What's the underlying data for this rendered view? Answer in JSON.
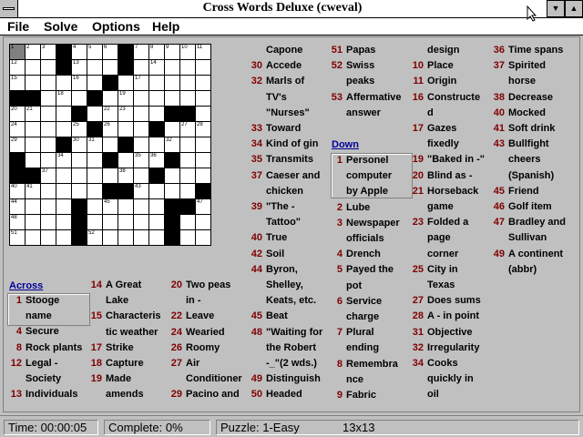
{
  "window": {
    "title": "Cross Words Deluxe (cweval)"
  },
  "menu": [
    "File",
    "Solve",
    "Options",
    "Help"
  ],
  "grid": {
    "rows": [
      "...#...#....",
      "...#...#....",
      "......#.....",
      "##...#......",
      "....#.....##",
      ".....#...#...",
      "...#...#.....",
      "#.....#...#..",
      "##.......#...",
      "......##....#",
      "....#.....##",
      "....#.....#.",
      "....#.....#.."
    ],
    "numbers": [
      [
        0,
        0,
        "1"
      ],
      [
        0,
        1,
        "2"
      ],
      [
        0,
        2,
        "3"
      ],
      [
        0,
        4,
        "4"
      ],
      [
        0,
        5,
        "5"
      ],
      [
        0,
        6,
        "6"
      ],
      [
        0,
        8,
        "7"
      ],
      [
        0,
        9,
        "8"
      ],
      [
        0,
        10,
        "9"
      ],
      [
        0,
        11,
        "10"
      ],
      [
        0,
        12,
        "11"
      ],
      [
        1,
        0,
        "12"
      ],
      [
        1,
        4,
        "13"
      ],
      [
        1,
        9,
        "14"
      ],
      [
        2,
        0,
        "15"
      ],
      [
        2,
        4,
        "16"
      ],
      [
        2,
        8,
        "17"
      ],
      [
        3,
        3,
        "18"
      ],
      [
        3,
        7,
        "19"
      ],
      [
        4,
        0,
        "20"
      ],
      [
        4,
        1,
        "21"
      ],
      [
        4,
        6,
        "22"
      ],
      [
        4,
        7,
        "23"
      ],
      [
        5,
        0,
        "24"
      ],
      [
        5,
        4,
        "25"
      ],
      [
        5,
        6,
        "26"
      ],
      [
        5,
        11,
        "27"
      ],
      [
        5,
        12,
        "28"
      ],
      [
        6,
        0,
        "29"
      ],
      [
        6,
        4,
        "30"
      ],
      [
        6,
        5,
        "31"
      ],
      [
        6,
        10,
        "32"
      ],
      [
        7,
        0,
        "33"
      ],
      [
        7,
        3,
        "34"
      ],
      [
        7,
        8,
        "35"
      ],
      [
        7,
        9,
        "36"
      ],
      [
        8,
        2,
        "37"
      ],
      [
        8,
        7,
        "38"
      ],
      [
        8,
        9,
        "39"
      ],
      [
        9,
        0,
        "40"
      ],
      [
        9,
        1,
        "41"
      ],
      [
        9,
        7,
        "42"
      ],
      [
        9,
        8,
        "43"
      ],
      [
        10,
        0,
        "44"
      ],
      [
        10,
        6,
        "45"
      ],
      [
        10,
        11,
        "46"
      ],
      [
        10,
        12,
        "47"
      ],
      [
        11,
        0,
        "48"
      ],
      [
        11,
        10,
        "50"
      ],
      [
        12,
        0,
        "51"
      ],
      [
        12,
        5,
        "52"
      ],
      [
        12,
        10,
        "53"
      ]
    ]
  },
  "across_header": "Across",
  "down_header": "Down",
  "across_clues": [
    [
      "1",
      "Stooge"
    ],
    [
      "",
      "name"
    ],
    [
      "4",
      "Secure"
    ],
    [
      "8",
      "Rock plants"
    ],
    [
      "12",
      "Legal -"
    ],
    [
      "",
      "Society"
    ],
    [
      "13",
      "Individuals"
    ],
    [
      "14",
      "A Great"
    ],
    [
      "",
      "Lake"
    ],
    [
      "15",
      "Characteris"
    ],
    [
      "",
      "tic weather"
    ],
    [
      "17",
      "Strike"
    ],
    [
      "18",
      "Capture"
    ],
    [
      "19",
      "Made"
    ],
    [
      "",
      "amends"
    ],
    [
      "20",
      "Two peas"
    ],
    [
      "",
      "in -"
    ],
    [
      "22",
      "Leave"
    ],
    [
      "24",
      "Wearied"
    ],
    [
      "26",
      "Roomy"
    ],
    [
      "27",
      "Air"
    ],
    [
      "",
      "Conditioner"
    ],
    [
      "29",
      "Pacino and"
    ],
    [
      "",
      "Capone"
    ],
    [
      "30",
      "Accede"
    ],
    [
      "32",
      "Marls of"
    ],
    [
      "",
      "TV's"
    ],
    [
      "",
      "\"Nurses\""
    ],
    [
      "33",
      "Toward"
    ],
    [
      "34",
      "Kind of gin"
    ],
    [
      "35",
      "Transmits"
    ],
    [
      "37",
      "Caeser and"
    ],
    [
      "",
      "chicken"
    ],
    [
      "39",
      "\"The -"
    ],
    [
      "",
      "Tattoo\""
    ],
    [
      "40",
      "True"
    ],
    [
      "42",
      "Soil"
    ],
    [
      "44",
      "Byron,"
    ],
    [
      "",
      "Shelley,"
    ],
    [
      "",
      "Keats, etc."
    ],
    [
      "45",
      "Beat"
    ],
    [
      "48",
      "\"Waiting for"
    ],
    [
      "",
      "the Robert"
    ],
    [
      "",
      "-_\"(2 wds.)"
    ],
    [
      "49",
      "Distinguish"
    ],
    [
      "50",
      "Headed"
    ],
    [
      "51",
      "Papas"
    ],
    [
      "52",
      "Swiss"
    ],
    [
      "",
      "peaks"
    ],
    [
      "53",
      "Affermative"
    ],
    [
      "",
      "answer"
    ]
  ],
  "down_clues": [
    [
      "1",
      "Personel"
    ],
    [
      "",
      "computer"
    ],
    [
      "",
      "by Apple"
    ],
    [
      "2",
      "Lube"
    ],
    [
      "3",
      "Newspaper"
    ],
    [
      "",
      "officials"
    ],
    [
      "4",
      "Drench"
    ],
    [
      "5",
      "Payed the"
    ],
    [
      "",
      "pot"
    ],
    [
      "6",
      "Service"
    ],
    [
      "",
      "charge"
    ],
    [
      "7",
      "Plural"
    ],
    [
      "",
      "ending"
    ],
    [
      "8",
      "Remembra"
    ],
    [
      "",
      "nce"
    ],
    [
      "9",
      "Fabric"
    ],
    [
      "",
      "design"
    ],
    [
      "10",
      "Place"
    ],
    [
      "11",
      "Origin"
    ],
    [
      "16",
      "Constructe"
    ],
    [
      "",
      "d"
    ],
    [
      "17",
      "Gazes"
    ],
    [
      "",
      "fixedly"
    ],
    [
      "19",
      "\"Baked in -\""
    ],
    [
      "20",
      "Blind as -"
    ],
    [
      "21",
      "Horseback"
    ],
    [
      "",
      "game"
    ],
    [
      "23",
      "Folded a"
    ],
    [
      "",
      "page"
    ],
    [
      "",
      "corner"
    ],
    [
      "25",
      "City in"
    ],
    [
      "",
      "Texas"
    ],
    [
      "27",
      "Does sums"
    ],
    [
      "28",
      "A - in point"
    ],
    [
      "31",
      "Objective"
    ],
    [
      "32",
      "Irregularity"
    ],
    [
      "34",
      "Cooks"
    ],
    [
      "",
      "quickly in"
    ],
    [
      "",
      "oil"
    ],
    [
      "36",
      "Time spans"
    ],
    [
      "37",
      "Spirited"
    ],
    [
      "",
      "horse"
    ],
    [
      "38",
      "Decrease"
    ],
    [
      "40",
      "Mocked"
    ],
    [
      "41",
      "Soft drink"
    ],
    [
      "43",
      "Bullfight"
    ],
    [
      "",
      "cheers"
    ],
    [
      "",
      "(Spanish)"
    ],
    [
      "45",
      "Friend"
    ],
    [
      "46",
      "Golf item"
    ],
    [
      "47",
      "Bradley and"
    ],
    [
      "",
      "Sullivan"
    ],
    [
      "49",
      "A continent"
    ],
    [
      "",
      "(abbr)"
    ]
  ],
  "status": {
    "time": "Time: 00:00:05",
    "complete": "Complete: 0%",
    "puzzle": "Puzzle: 1-Easy",
    "size": "13x13"
  }
}
